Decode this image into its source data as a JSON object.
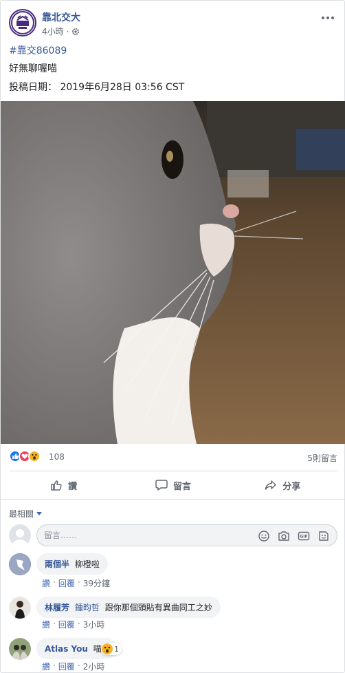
{
  "post": {
    "page_name": "靠北交大",
    "time": "4小時",
    "separator": "·",
    "hashtag": "#靠交86089",
    "body": "好無聊喔喵",
    "posted": "投稿日期： 2019年6月28日 03:56 CST"
  },
  "icons": {
    "more": "more-icon",
    "audience": "gear-icon",
    "like": "thumbs-up-icon",
    "comment": "speech-bubble-icon",
    "share": "share-arrow-icon"
  },
  "reactions": {
    "types": [
      "like",
      "love",
      "wow"
    ],
    "count": "108",
    "comments_count": "5則留言"
  },
  "actions": {
    "like": "讚",
    "comment": "留言",
    "share": "分享"
  },
  "comments_section": {
    "sort_label": "最相關",
    "composer_placeholder": "留言……"
  },
  "comments": [
    {
      "name": "兩個半",
      "tag": "",
      "text": "柳橙啦",
      "like": "讚",
      "reply": "回覆",
      "dot": "·",
      "time": "39分鐘"
    },
    {
      "name": "林履芳",
      "tag": "鍾昀哲",
      "text": "跟你那個頭貼有異曲同工之妙",
      "like": "讚",
      "reply": "回覆",
      "dot": "·",
      "time": "3小時"
    },
    {
      "name": "Atlas You",
      "tag": "",
      "text": "喵",
      "like": "讚",
      "reply": "回覆",
      "dot": "·",
      "time": "2小時",
      "reaction_count": "1"
    }
  ],
  "colors": {
    "link": "#385898",
    "accent": "#4267b2",
    "like": "#1877f2",
    "love": "#f33e58",
    "wow": "#f7b125"
  }
}
